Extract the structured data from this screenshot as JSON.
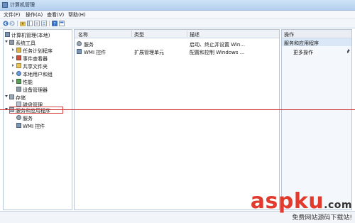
{
  "window": {
    "title": "计算机管理"
  },
  "menubar": [
    {
      "label": "文件(F)"
    },
    {
      "label": "操作(A)"
    },
    {
      "label": "查看(V)"
    },
    {
      "label": "帮助(H)"
    }
  ],
  "tree": {
    "items": [
      {
        "label": "计算机管理(本地)"
      },
      {
        "label": "系统工具"
      },
      {
        "label": "任务计划程序"
      },
      {
        "label": "事件查看器"
      },
      {
        "label": "共享文件夹"
      },
      {
        "label": "本地用户和组"
      },
      {
        "label": "性能"
      },
      {
        "label": "设备管理器"
      },
      {
        "label": "存储"
      },
      {
        "label": "磁盘管理"
      },
      {
        "label": "服务和应用程序"
      },
      {
        "label": "服务"
      },
      {
        "label": "WMI 控件"
      }
    ]
  },
  "table": {
    "headers": [
      "名称",
      "类型",
      "描述"
    ],
    "rows": [
      {
        "name": "服务",
        "type": "",
        "desc": "启动、终止并设置 Win..."
      },
      {
        "name": "WMI 控件",
        "type": "扩展管理单元",
        "desc": "配置和控制 Windows ..."
      }
    ]
  },
  "actions": {
    "title": "操作",
    "section": "服务和应用程序",
    "link": "更多操作"
  },
  "watermark": {
    "main": "aspku",
    "suffix": ".com",
    "sub": "免费网站源码下载站!"
  },
  "colors": {
    "accent": "#d02b2b",
    "watermark": "#e23b2e"
  }
}
